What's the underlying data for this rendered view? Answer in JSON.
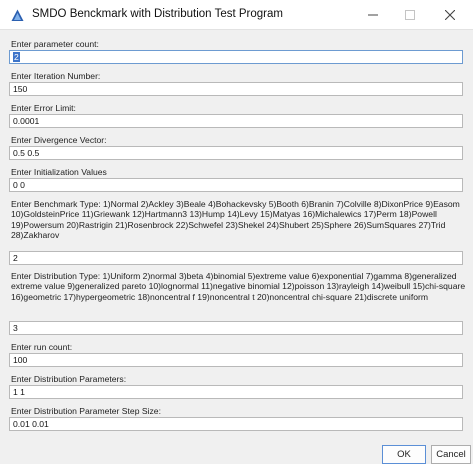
{
  "window": {
    "title": "SMDO Benckmark with Distribution Test Program",
    "icon": "java-app-icon",
    "controls": [
      "minimize-icon",
      "maximize-icon",
      "close-icon"
    ]
  },
  "fields": {
    "param_count": {
      "label": "Enter parameter count:",
      "value": "2"
    },
    "iterations": {
      "label": "Enter Iteration Number:",
      "value": "150"
    },
    "error_limit": {
      "label": "Enter Error Limit:",
      "value": "0.0001"
    },
    "divergence": {
      "label": "Enter Divergence Vector:",
      "value": "0.5 0.5"
    },
    "init_values": {
      "label": "Enter Initialization Values",
      "value": "0 0"
    },
    "benchmark": {
      "label": "Enter Benchmark Type:  1)Normal 2)Ackley 3)Beale 4)Bohackevsky 5)Booth 6)Branin 7)Colville 8)DixonPrice 9)Easom 10)GoldsteinPrice 11)Griewank 12)Hartmann3 13)Hump 14)Levy 15)Matyas 16)Michalewics 17)Perm 18)Powell 19)Powersum 20)Rastrigin 21)Rosenbrock 22)Schwefel 23)Shekel 24)Shubert 25)Sphere 26)SumSquares 27)Trid 28)Zakharov",
      "value": "2"
    },
    "distribution": {
      "label": "Enter Distribution Type:  1)Uniform 2)normal 3)beta 4)binomial 5)extreme value 6)exponential 7)gamma 8)generalized extreme value 9)generalized pareto 10)lognormal 11)negative binomial 12)poisson 13)rayleigh 14)weibull 15)chi-square 16)geometric 17)hypergeometric 18)noncentral f 19)noncentral t 20)noncentral chi-square 21)discrete uniform",
      "value": "3"
    },
    "run_count": {
      "label": "Enter run count:",
      "value": "100"
    },
    "dist_params": {
      "label": "Enter Distribution Parameters:",
      "value": "1 1"
    },
    "step_size": {
      "label": "Enter Distribution Parameter Step Size:",
      "value": "0.01 0.01"
    }
  },
  "buttons": {
    "ok": "OK",
    "cancel": "Cancel"
  },
  "colors": {
    "selection": "#3d74c9",
    "window_bg": "#f0f0f0"
  }
}
